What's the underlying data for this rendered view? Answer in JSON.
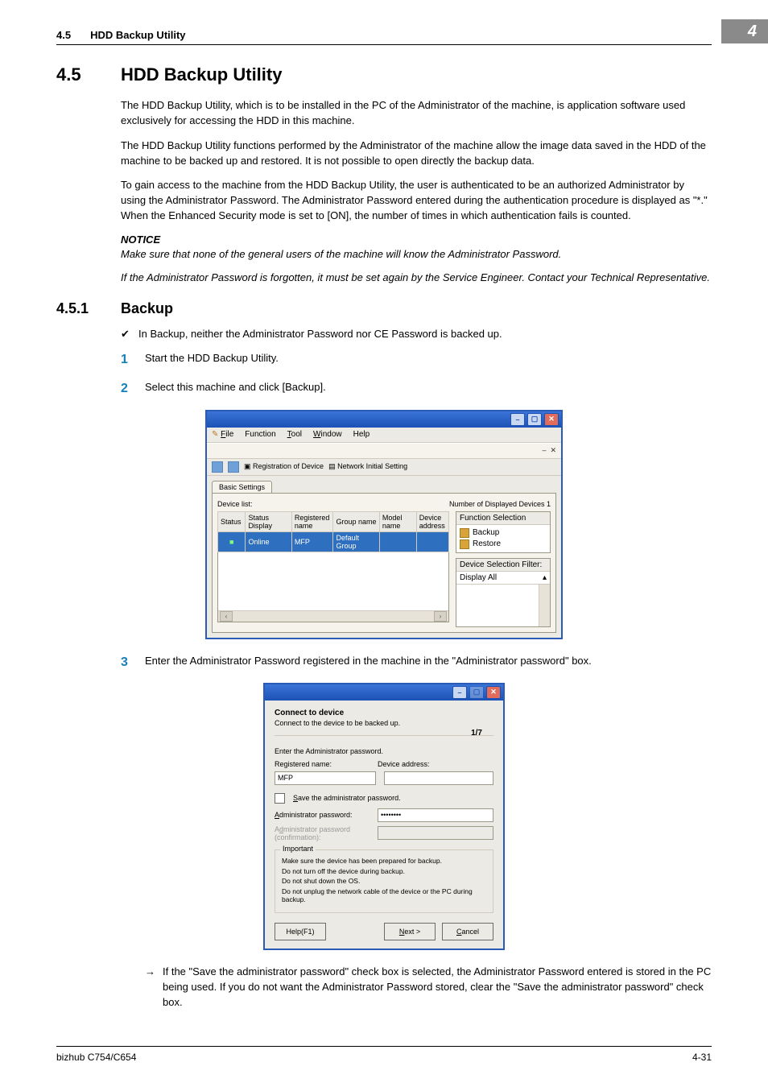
{
  "running_head": {
    "num": "4.5",
    "title": "HDD Backup Utility",
    "tab": "4"
  },
  "section": {
    "number": "4.5",
    "title": "HDD Backup Utility",
    "p1": "The HDD Backup Utility, which is to be installed in the PC of the Administrator of the machine, is application software used exclusively for accessing the HDD in this machine.",
    "p2": "The HDD Backup Utility functions performed by the Administrator of the machine allow the image data saved in the HDD of the machine to be backed up and restored. It is not possible to open directly the backup data.",
    "p3": "To gain access to the machine from the HDD Backup Utility, the user is authenticated to be an authorized Administrator by using the Administrator Password. The Administrator Password entered during the authentication procedure is displayed as \"*.\" When the Enhanced Security mode is set to [ON], the number of times in which authentication fails is counted.",
    "notice_hd": "NOTICE",
    "notice1": "Make sure that none of the general users of the machine will know the Administrator Password.",
    "notice2": "If the Administrator Password is forgotten, it must be set again by the Service Engineer. Contact your Technical Representative."
  },
  "subsection": {
    "number": "4.5.1",
    "title": "Backup",
    "bullet": "In Backup, neither the Administrator Password nor CE Password is backed up.",
    "step1": "Start the HDD Backup Utility.",
    "step2": "Select this machine and click [Backup].",
    "step3": "Enter the Administrator Password registered in the machine in the \"Administrator password\" box.",
    "arrow": "If the \"Save the administrator password\" check box is selected, the Administrator Password entered is stored in the PC being used. If you do not want the Administrator Password stored, clear the \"Save the administrator password\" check box."
  },
  "win1": {
    "menus": {
      "file": "File",
      "function": "Function",
      "tool": "Tool",
      "window": "Window",
      "help": "Help"
    },
    "mdi_close": "– ✕",
    "toolbar": {
      "reg": "Registration of Device",
      "net": "Network Initial Setting"
    },
    "tab": "Basic Settings",
    "device_list_label": "Device list:",
    "num_devices": "Number of Displayed Devices 1",
    "table_headers": {
      "status": "Status",
      "status_disp": "Status Display",
      "reg_name": "Registered name",
      "group": "Group name",
      "model": "Model name",
      "addr": "Device address"
    },
    "table_row": {
      "status_icon": "●",
      "status_disp": "Online",
      "reg_name": "MFP",
      "group": "Default Group",
      "model": "",
      "addr": ""
    },
    "side": {
      "function_selection": "Function Selection",
      "backup": "Backup",
      "restore": "Restore",
      "filter_hd": "Device Selection Filter:",
      "filter_val": "Display All"
    }
  },
  "win2": {
    "title": "Connect to device",
    "subtitle": "Connect to the device to be backed up.",
    "step": "1/7",
    "enter_pw": "Enter the Administrator password.",
    "reg_name_label": "Registered name:",
    "reg_name_value": "MFP",
    "dev_addr_label": "Device address:",
    "dev_addr_value": "",
    "save_pw": "Save the administrator password.",
    "admin_pw_label": "Administrator password:",
    "admin_pw_value": "••••••••",
    "admin_pw_conf_label": "Administrator password (confirmation):",
    "important_hd": "Important",
    "imp1": "Make sure the device has been prepared for backup.",
    "imp2": "Do not turn off the device during backup.",
    "imp3": "Do not shut down the OS.",
    "imp4": "Do not unplug the network cable of the device or the PC during backup.",
    "help": "Help(F1)",
    "next": "Next >",
    "cancel": "Cancel"
  },
  "footer": {
    "left": "bizhub C754/C654",
    "right": "4-31"
  }
}
